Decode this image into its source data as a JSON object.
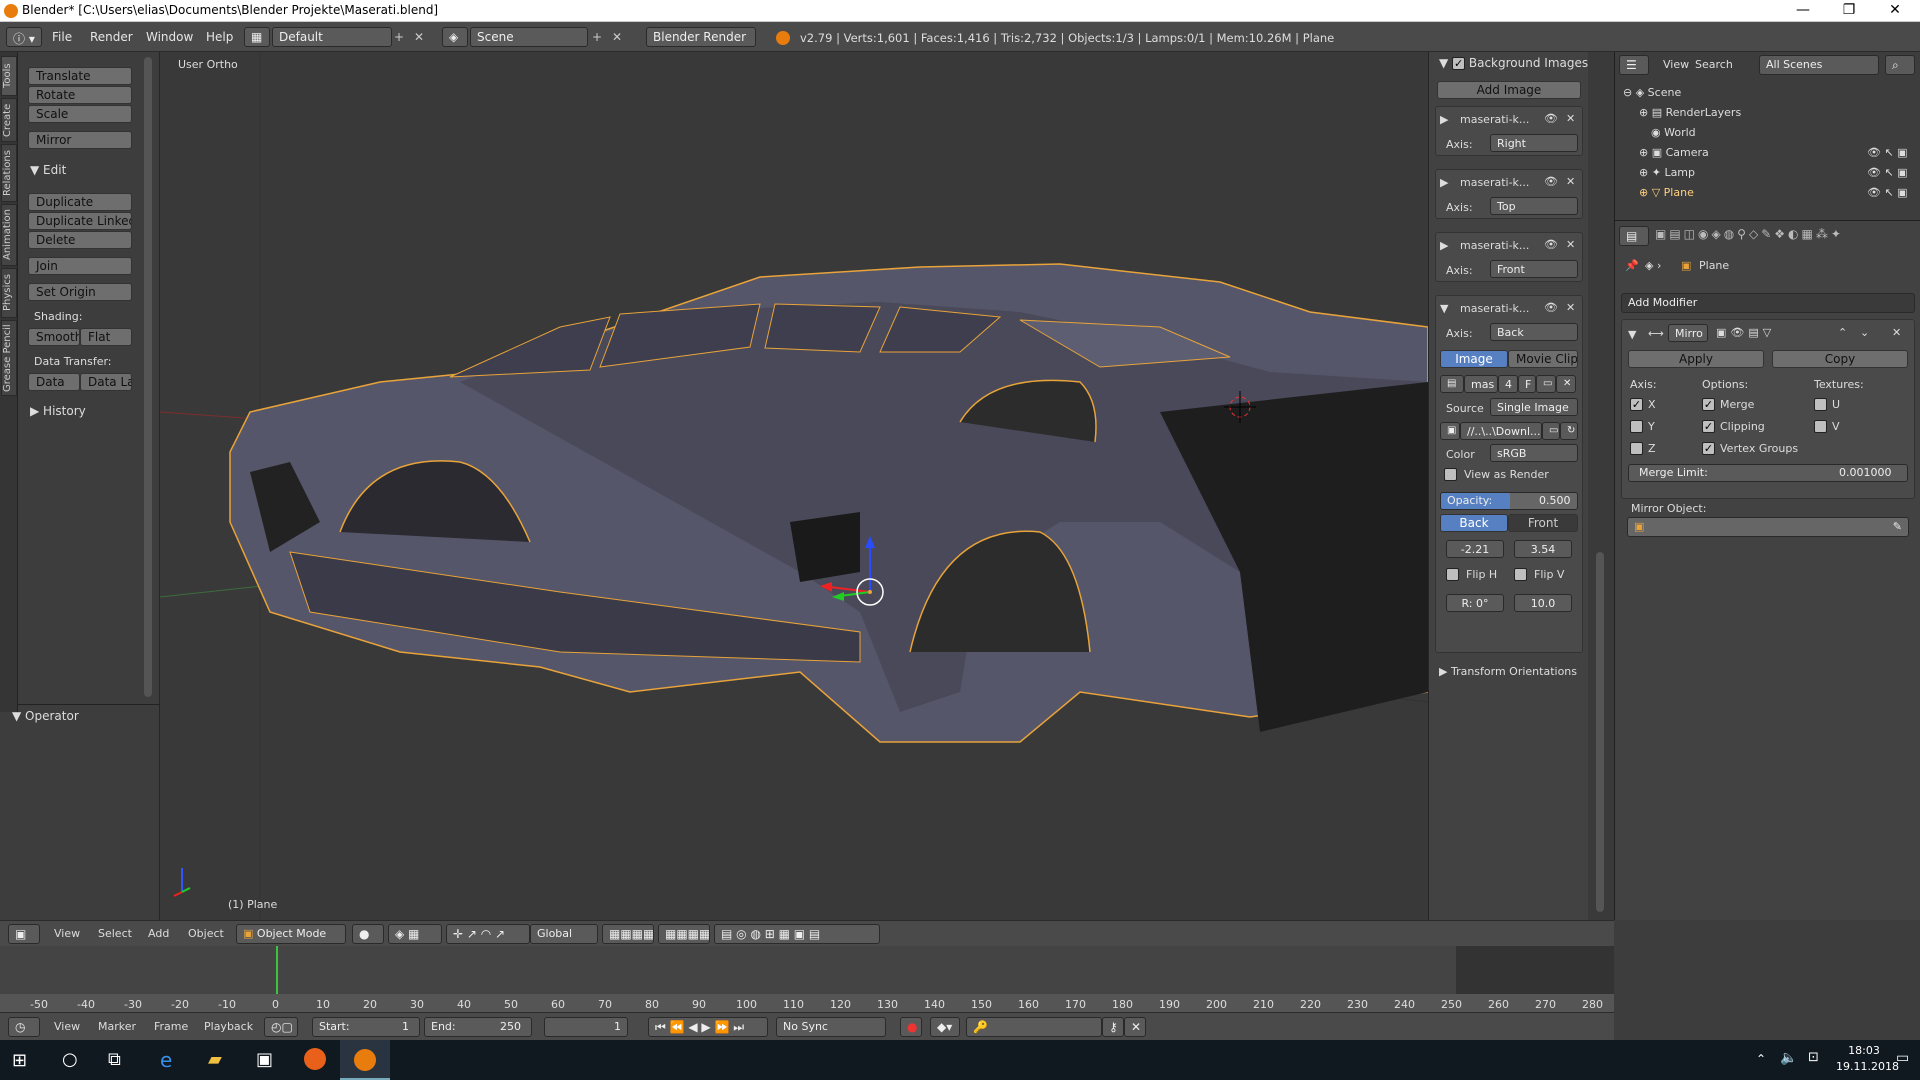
{
  "window": {
    "title": "Blender* [C:\\Users\\elias\\Documents\\Blender Projekte\\Maserati.blend]"
  },
  "menubar": {
    "menus": [
      "File",
      "Render",
      "Window",
      "Help"
    ],
    "layout": "Default",
    "scene": "Scene",
    "engine": "Blender Render",
    "stats": "v2.79 | Verts:1,601 | Faces:1,416 | Tris:2,732 | Objects:1/3 | Lamps:0/1 | Mem:10.26M | Plane"
  },
  "tools": {
    "tabs": [
      "Tools",
      "Create",
      "Relations",
      "Animation",
      "Physics",
      "Grease Pencil"
    ],
    "transform": [
      "Translate",
      "Rotate",
      "Scale"
    ],
    "mirror": "Mirror",
    "edit_header": "Edit",
    "edit": [
      "Duplicate",
      "Duplicate Linked",
      "Delete"
    ],
    "join": "Join",
    "set_origin": "Set Origin",
    "shading_label": "Shading:",
    "smooth": "Smooth",
    "flat": "Flat",
    "data_transfer_label": "Data Transfer:",
    "data": "Data",
    "data_la": "Data La",
    "history": "History",
    "operator": "Operator"
  },
  "viewport": {
    "view_name": "User Ortho",
    "object_label": "(1) Plane"
  },
  "bgimages": {
    "header": "Background Images",
    "add_image": "Add Image",
    "axis_label": "Axis:",
    "items": [
      {
        "name": "maserati-k...",
        "axis": "Right"
      },
      {
        "name": "maserati-k...",
        "axis": "Top"
      },
      {
        "name": "maserati-k...",
        "axis": "Front"
      },
      {
        "name": "maserati-k...",
        "axis": "Back"
      }
    ],
    "image_tab": "Image",
    "movieclip_tab": "Movie Clip",
    "datablock": "mas",
    "users": "4",
    "fake": "F",
    "source_label": "Source",
    "source": "Single Image",
    "path": "//..\\..\\Downl...",
    "color_label": "Color",
    "color": "sRGB",
    "view_as_render": "View as Render",
    "opacity_label": "Opacity:",
    "opacity": "0.500",
    "back": "Back",
    "front": "Front",
    "offset_x": "-2.21",
    "offset_y": "3.54",
    "flip_h": "Flip H",
    "flip_v": "Flip V",
    "rotation": "R: 0°",
    "size": "10.0",
    "transform_orient": "Transform Orientations"
  },
  "outliner": {
    "view": "View",
    "search": "Search",
    "filter": "All Scenes",
    "items": [
      {
        "label": "Scene",
        "depth": 0
      },
      {
        "label": "RenderLayers",
        "depth": 1
      },
      {
        "label": "World",
        "depth": 1
      },
      {
        "label": "Camera",
        "depth": 1
      },
      {
        "label": "Lamp",
        "depth": 1
      },
      {
        "label": "Plane",
        "depth": 1
      }
    ]
  },
  "properties": {
    "object": "Plane",
    "add_modifier": "Add Modifier",
    "modifier_name": "Mirro",
    "apply": "Apply",
    "copy": "Copy",
    "axis_label": "Axis:",
    "options_label": "Options:",
    "textures_label": "Textures:",
    "axes": [
      "X",
      "Y",
      "Z"
    ],
    "axes_checked": [
      true,
      false,
      false
    ],
    "options": [
      "Merge",
      "Clipping",
      "Vertex Groups"
    ],
    "options_checked": [
      true,
      true,
      true
    ],
    "textures": [
      "U",
      "V"
    ],
    "textures_checked": [
      false,
      false
    ],
    "merge_limit_label": "Merge Limit:",
    "merge_limit": "0.001000",
    "mirror_object_label": "Mirror Object:"
  },
  "vpheader": {
    "menus": [
      "View",
      "Select",
      "Add",
      "Object"
    ],
    "mode": "Object Mode",
    "orientation": "Global"
  },
  "timeline": {
    "ticks": [
      "-50",
      "-40",
      "-30",
      "-20",
      "-10",
      "0",
      "10",
      "20",
      "30",
      "40",
      "50",
      "60",
      "70",
      "80",
      "90",
      "100",
      "110",
      "120",
      "130",
      "140",
      "150",
      "160",
      "170",
      "180",
      "190",
      "200",
      "210",
      "220",
      "230",
      "240",
      "250",
      "260",
      "270",
      "280"
    ]
  },
  "tlheader": {
    "menus": [
      "View",
      "Marker",
      "Frame",
      "Playback"
    ],
    "start_label": "Start:",
    "start": "1",
    "end_label": "End:",
    "end": "250",
    "current": "1",
    "sync": "No Sync"
  },
  "taskbar": {
    "time": "18:03",
    "date": "19.11.2018"
  }
}
